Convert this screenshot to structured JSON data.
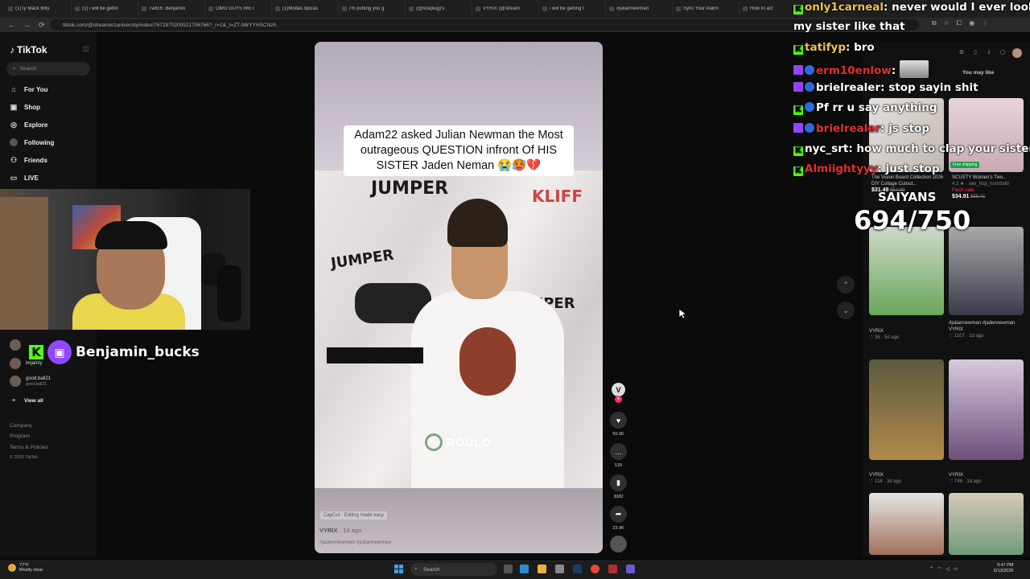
{
  "browser": {
    "tabs": [
      "(1)Ty Mack Billy",
      "(1) i will be gettin",
      "Twitch: Benjamin",
      "OMG GUYS WE I",
      "(1)Modas tipicas",
      "i'm putting you g",
      "(@riceplug)'s",
      "VYRIX (@stream",
      "i will be getting t",
      "#juliannewman",
      "Sync Your Alarm",
      "How to act"
    ],
    "url": "tiktok.com/@streamerzuniversity/video/7672970200521706766?_r=1&_t=ZT-98rYYHSCNzh"
  },
  "tiktok": {
    "logo": "TikTok",
    "search_placeholder": "Search",
    "nav": [
      {
        "label": "For You",
        "icon": "home-icon"
      },
      {
        "label": "Shop",
        "icon": "shop-icon"
      },
      {
        "label": "Explore",
        "icon": "compass-icon"
      },
      {
        "label": "Following",
        "icon": "following-icon"
      },
      {
        "label": "Friends",
        "icon": "friends-icon"
      },
      {
        "label": "LIVE",
        "icon": "live-icon"
      }
    ],
    "following": [
      {
        "name": "imjanxy",
        "sub": "imjanxy"
      },
      {
        "name": "good.ball21",
        "sub": "good.ball21"
      }
    ],
    "view_all": "View all",
    "footer": [
      "Company",
      "Program",
      "Terms & Policies",
      "© 2026 TikTok"
    ]
  },
  "stream": {
    "streamer_name": "Benjamin_bucks",
    "counter_label": "SAIYANS",
    "counter": "694/750"
  },
  "video": {
    "caption": "Adam22 asked Julian Newman the Most outrageous QUESTION infront Of HIS SISTER Jaden Neman 😭🥵💔",
    "watermark": "ROULO",
    "capcut": "CapCut · Editing made easy",
    "author": "VYRIX",
    "posted": "· 1d ago",
    "tags": "#jadennewman #juliannewman",
    "creator_initial": "V",
    "likes": "50.6K",
    "comments": "539",
    "saves": "3082",
    "shares": "23.9K"
  },
  "chat": [
    {
      "badges": [
        "kick"
      ],
      "user": "only1carneal",
      "color": "#f2c14e",
      "msg": "never would I ever look at"
    },
    {
      "badges": [],
      "user": "",
      "color": "#fff",
      "msg": "my sister like that"
    },
    {
      "badges": [
        "kick"
      ],
      "user": "tatifyp",
      "color": "#f2c14e",
      "msg": "bro"
    },
    {
      "badges": [
        "twitch",
        "sub"
      ],
      "user": "erm10enlow",
      "color": "#e0312f",
      "msg": ""
    },
    {
      "badges": [
        "twitch",
        "sub"
      ],
      "user": "brielrealer",
      "color": "#fff",
      "msg": "stop sayin shit"
    },
    {
      "badges": [
        "kick",
        "sub"
      ],
      "user": "Pf",
      "color": "#fff",
      "msg": "rr u say anything"
    },
    {
      "badges": [
        "twitch",
        "sub"
      ],
      "user": "brielrealer",
      "color": "#fff",
      "msg": "js stop"
    },
    {
      "badges": [
        "kick"
      ],
      "user": "nyc_srt",
      "color": "#fff",
      "msg": "how much to clap your sister?"
    },
    {
      "badges": [
        "kick"
      ],
      "user": "Almiightyyy",
      "color": "#e0312f",
      "msg": "just stop"
    }
  ],
  "right_panel": {
    "heading": "You may like",
    "items": [
      {
        "title": "The Vision Board Collection 2026 DIY Collage Cutout...",
        "sub": "",
        "price": "$31.49",
        "old": "$54.99",
        "badge": ""
      },
      {
        "title": "SCUSTY Women's Two...",
        "sub": "4.2 ★ · seo_hop_numSold",
        "price": "$34.91",
        "old": "$55.41",
        "badge": "Flash sale"
      },
      {
        "author": "VYRIX",
        "likes": "36",
        "time": "5d ago",
        "title": ""
      },
      {
        "author": "VYRIX",
        "likes": "1107",
        "time": "1d ago",
        "title": "#juliannewman #jadennewman"
      },
      {
        "author": "VYRIX",
        "likes": "118",
        "time": "3d ago",
        "title": ""
      },
      {
        "author": "VYRIX",
        "likes": "746",
        "time": "1d ago",
        "title": ""
      }
    ],
    "free_shipping": "Free shipping"
  },
  "taskbar": {
    "temp": "77°F",
    "weather": "Mostly clear",
    "search": "Search",
    "time": "9:47 PM",
    "date": "6/13/2026"
  }
}
